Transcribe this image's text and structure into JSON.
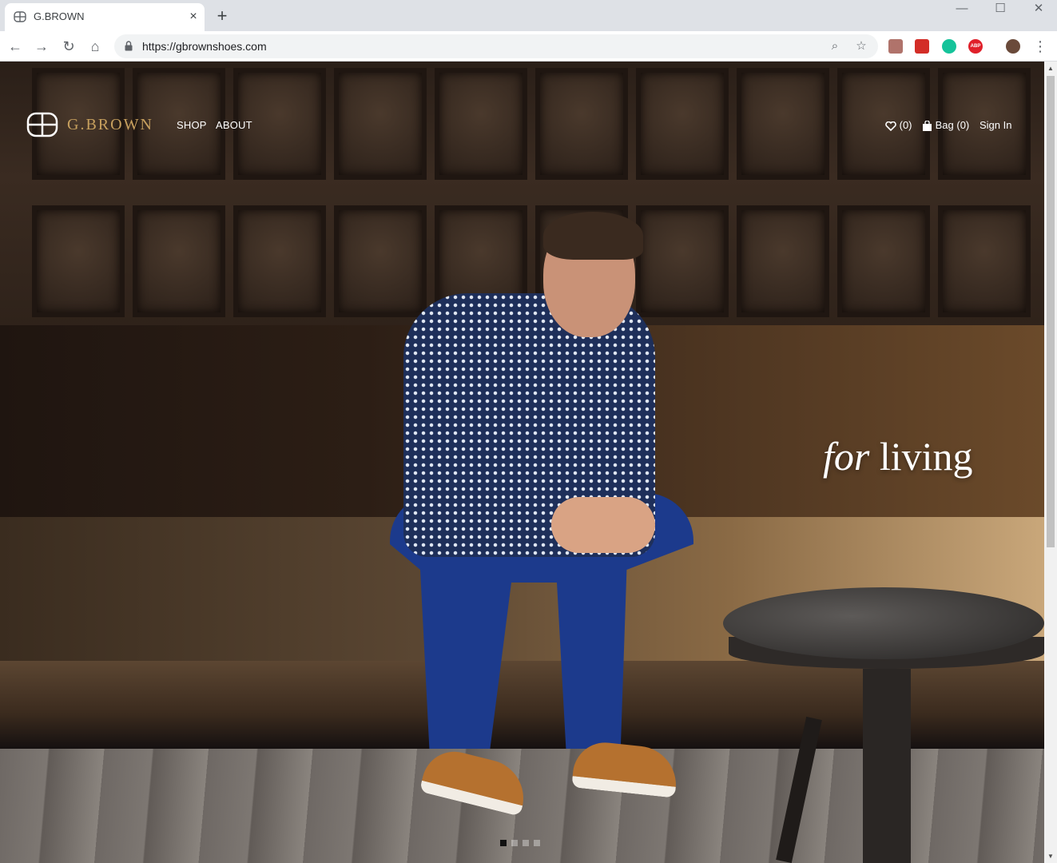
{
  "browser": {
    "tab": {
      "title": "G.BROWN",
      "close_glyph": "×",
      "favicon": "gbrown-logo-icon"
    },
    "new_tab_glyph": "+",
    "window_controls": {
      "minimize": "—",
      "maximize": "☐",
      "close": "✕"
    },
    "nav": {
      "back": "←",
      "forward": "→",
      "reload": "↻",
      "home": "⌂"
    },
    "address_bar": {
      "url": "https://gbrownshoes.com",
      "lock_icon": "lock-icon"
    },
    "omnibox_icons": {
      "zoom": "⌕",
      "bookmark": "☆"
    },
    "extensions": [
      {
        "name": "pdf-extension-icon",
        "color": "#b0736b"
      },
      {
        "name": "lastpass-extension-icon",
        "color": "#d32d27"
      },
      {
        "name": "grammarly-extension-icon",
        "color": "#15c39a"
      },
      {
        "name": "adblock-plus-extension-icon",
        "color": "#e0202a",
        "label": "ABP"
      },
      {
        "name": "profile-avatar-icon",
        "color": "#6a4a3a"
      }
    ],
    "menu_glyph": "⋮"
  },
  "site": {
    "brand": "G.BROWN",
    "brand_color": "#c7a05e",
    "nav": [
      "SHOP",
      "ABOUT"
    ],
    "utility": {
      "wishlist_count": "(0)",
      "bag_label": "Bag (0)",
      "sign_in": "Sign In"
    },
    "hero": {
      "tagline_italic": "for",
      "tagline_rest": "living",
      "slides": 4,
      "active_slide": 1
    }
  }
}
